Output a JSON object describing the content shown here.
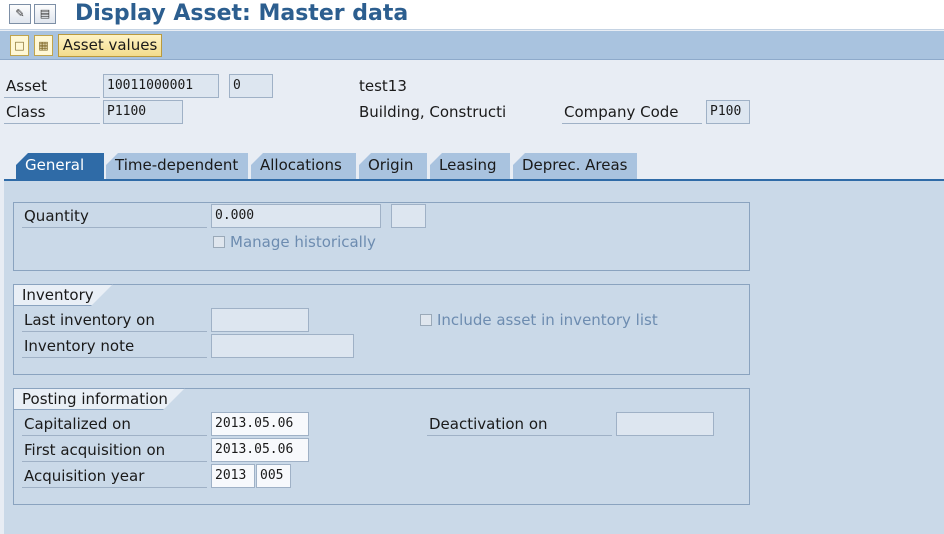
{
  "window": {
    "title": "Display Asset:  Master data"
  },
  "toolbar": {
    "icons": [
      "display-change-icon",
      "info-icon"
    ],
    "app_icons": [
      "other-asset-icon",
      "document-icon"
    ],
    "asset_values_label": "Asset values"
  },
  "header": {
    "asset_label": "Asset",
    "asset_value": "10011000001",
    "sub_number": "0",
    "asset_description": "test13",
    "class_label": "Class",
    "class_value": "P1100",
    "class_description": "Building, Constructi",
    "company_code_label": "Company Code",
    "company_code_value": "P100"
  },
  "tabs": [
    {
      "label": "General",
      "active": true
    },
    {
      "label": "Time-dependent",
      "active": false
    },
    {
      "label": "Allocations",
      "active": false
    },
    {
      "label": "Origin",
      "active": false
    },
    {
      "label": "Leasing",
      "active": false
    },
    {
      "label": "Deprec. Areas",
      "active": false
    }
  ],
  "general": {
    "quantity_label": "Quantity",
    "quantity_value": "0.000",
    "unit_value": "",
    "manage_historically_label": "Manage historically",
    "manage_historically_checked": false
  },
  "inventory": {
    "title": "Inventory",
    "last_inventory_label": "Last inventory on",
    "last_inventory_value": "",
    "inventory_note_label": "Inventory note",
    "inventory_note_value": "",
    "include_in_list_label": "Include asset in inventory list",
    "include_in_list_checked": false
  },
  "posting": {
    "title": "Posting information",
    "capitalized_label": "Capitalized on",
    "capitalized_value": "2013.05.06",
    "first_acquisition_label": "First acquisition on",
    "first_acquisition_value": "2013.05.06",
    "acquisition_year_label": "Acquisition year",
    "acquisition_year_value": "2013",
    "acquisition_period_value": "005",
    "deactivation_label": "Deactivation on",
    "deactivation_value": ""
  },
  "colors": {
    "title": "#2c5e8f",
    "toolbar": "#a9c3df",
    "tab_active": "#2f6ba7",
    "panel": "#cad9e8"
  }
}
